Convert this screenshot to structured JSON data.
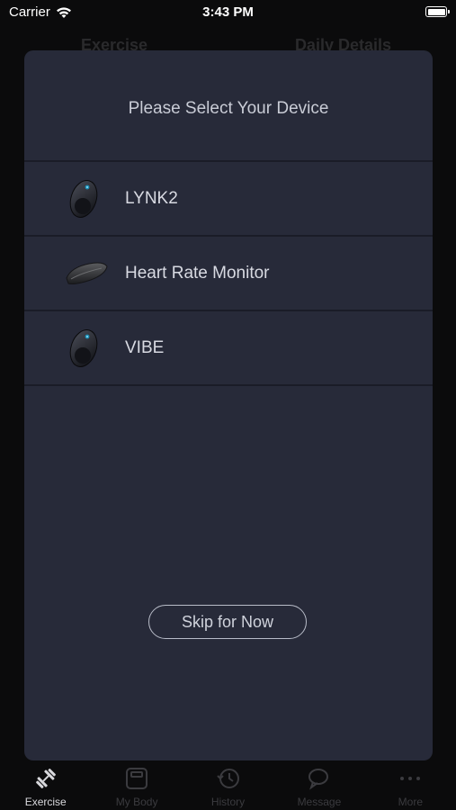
{
  "status_bar": {
    "carrier": "Carrier",
    "time": "3:43 PM"
  },
  "background": {
    "tab_left": "Exercise",
    "tab_right": "Daily Details"
  },
  "modal": {
    "title": "Please Select Your Device",
    "devices": [
      {
        "label": "LYNK2",
        "icon": "lynk2-device-icon"
      },
      {
        "label": "Heart Rate Monitor",
        "icon": "heart-rate-monitor-icon"
      },
      {
        "label": "VIBE",
        "icon": "vibe-device-icon"
      }
    ],
    "skip_label": "Skip for Now"
  },
  "tab_bar": {
    "items": [
      {
        "label": "Exercise",
        "icon": "dumbbell-icon",
        "active": true
      },
      {
        "label": "My Body",
        "icon": "scale-icon",
        "active": false
      },
      {
        "label": "History",
        "icon": "history-icon",
        "active": false
      },
      {
        "label": "Message",
        "icon": "chat-bubbles-icon",
        "active": false
      },
      {
        "label": "More",
        "icon": "more-dots-icon",
        "active": false
      }
    ]
  },
  "colors": {
    "modal_bg": "#272a39",
    "divider": "#1a1c27",
    "text": "#d8dae2",
    "active_tab": "#d8d8dc",
    "inactive_tab": "#3b3b3f"
  }
}
